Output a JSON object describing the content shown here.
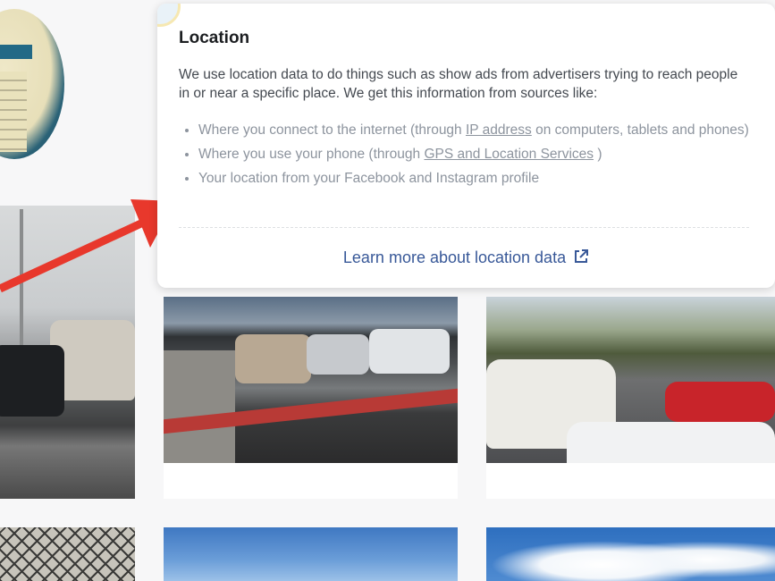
{
  "popover": {
    "title": "Location",
    "intro": "We use location data to do things such as show ads from advertisers trying to reach people in or near a specific place. We get this information from sources like:",
    "items": [
      {
        "before": "Where you connect to the internet (through ",
        "link": "IP address",
        "after": " on computers, tablets and phones)"
      },
      {
        "before": "Where you use your phone (through ",
        "link": "GPS and Location Services",
        "after": " )"
      },
      {
        "before": "Your location from your Facebook and Instagram profile",
        "link": "",
        "after": ""
      }
    ],
    "learn_more": "Learn more about location data",
    "learn_more_icon": "external-link-icon"
  },
  "colors": {
    "accent": "#385898",
    "arrow": "#e8382c",
    "muted_text": "#8d949e",
    "body_text": "#444950"
  }
}
